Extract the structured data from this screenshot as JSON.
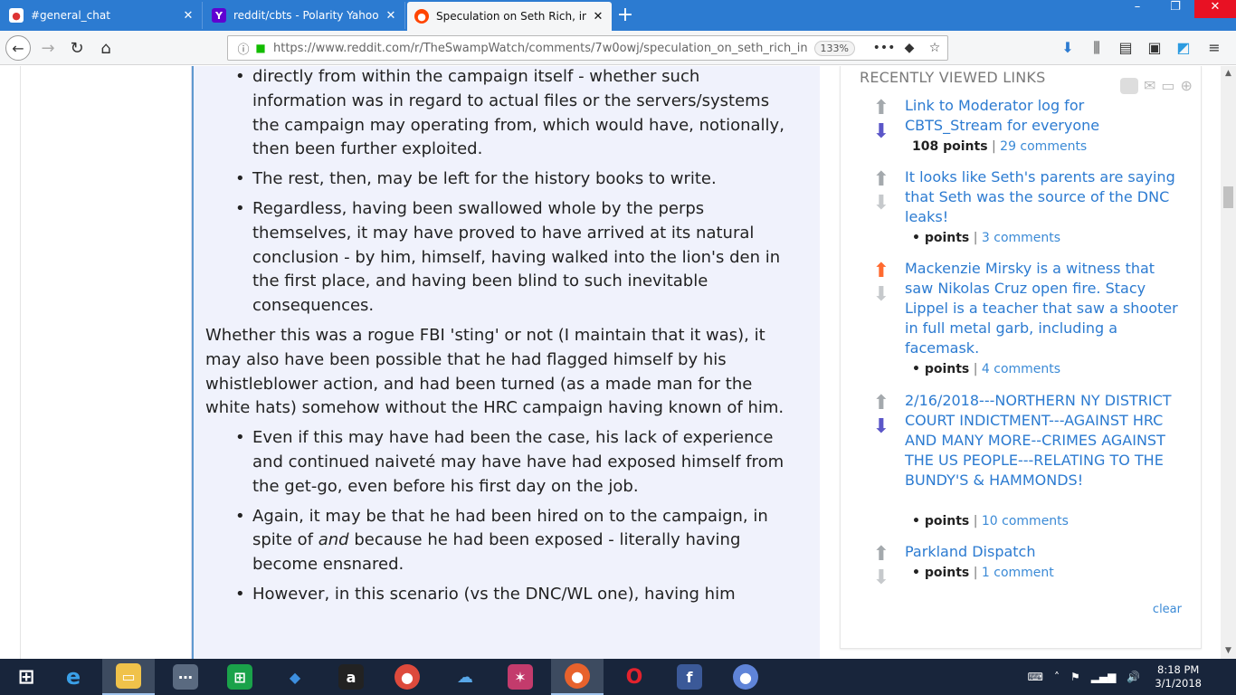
{
  "browser": {
    "tabs": [
      {
        "title": "#general_chat",
        "icon": "chat-icon",
        "active": false
      },
      {
        "title": "reddit/cbts - Polarity Yahoo Se",
        "icon": "yahoo-icon",
        "active": false
      },
      {
        "title": "Speculation on Seth Rich, in lig",
        "icon": "reddit-icon",
        "active": true
      }
    ],
    "url": "https://www.reddit.com/r/TheSwampWatch/comments/7w0owj/speculation_on_seth_rich_in",
    "zoom": "133%"
  },
  "comment": {
    "bullets_a": [
      "directly from within the campaign itself - whether such information was in regard to actual files or the servers/systems the campaign may operating from, which would have, notionally, then been further exploited.",
      "The rest, then, may be left for the history books to write.",
      "Regardless, having been swallowed whole by the perps themselves, it may have proved to have arrived at its natural conclusion - by him, himself, having walked into the lion's den in the first place, and having been blind to such inevitable consequences."
    ],
    "paragraph": "Whether this was a rogue FBI 'sting' or not (I maintain that it was), it may also have been possible that he had flagged himself by his whistleblower action, and had been turned (as a made man for the white hats) somehow without the HRC campaign having known of him.",
    "bullets_b": [
      "Even if this may have had been the case, his lack of experience and continued naiveté may have have had exposed himself from the get-go, even before his first day on the job."
    ],
    "bullet_c_pre": "Again, it may be that he had been hired on to the campaign, in spite of ",
    "bullet_c_em": "and",
    "bullet_c_post": " because he had been exposed - literally having become ensnared.",
    "bullet_d": "However, in this scenario (vs the DNC/WL one), having him"
  },
  "sidebar": {
    "title": "RECENTLY VIEWED LINKS",
    "clear_label": "clear",
    "links": [
      {
        "title": "Link to Moderator log for CBTS_Stream for everyone",
        "points": "108 points",
        "comments": "29 comments",
        "vote": "down"
      },
      {
        "title": "It looks like Seth's parents are saying that Seth was the source of the DNC leaks!",
        "points": "• points",
        "comments": "3 comments",
        "vote": "none"
      },
      {
        "title": "Mackenzie Mirsky is a witness that saw Nikolas Cruz open fire. Stacy Lippel is a teacher that saw a shooter in full metal garb, including a facemask.",
        "points": "• points",
        "comments": "4 comments",
        "vote": "up"
      },
      {
        "title": "2/16/2018---NORTHERN NY DISTRICT COURT INDICTMENT---AGAINST HRC AND MANY MORE--CRIMES AGAINST THE US PEOPLE---RELATING TO THE BUNDY'S & HAMMONDS!",
        "points": "• points",
        "comments": "10 comments",
        "vote": "down"
      },
      {
        "title": "Parkland Dispatch",
        "points": "• points",
        "comments": "1 comment",
        "vote": "none"
      }
    ]
  },
  "taskbar": {
    "time": "8:18 PM",
    "date": "3/1/2018",
    "apps": [
      "start-icon",
      "ie-icon",
      "file-explorer-icon",
      "network-icon",
      "store-icon",
      "dropbox-icon",
      "amazon-icon",
      "chrome-icon",
      "onedrive-icon",
      "paint-icon",
      "firefox-icon",
      "opera-icon",
      "facebook-icon",
      "chrome-canary-icon"
    ]
  }
}
